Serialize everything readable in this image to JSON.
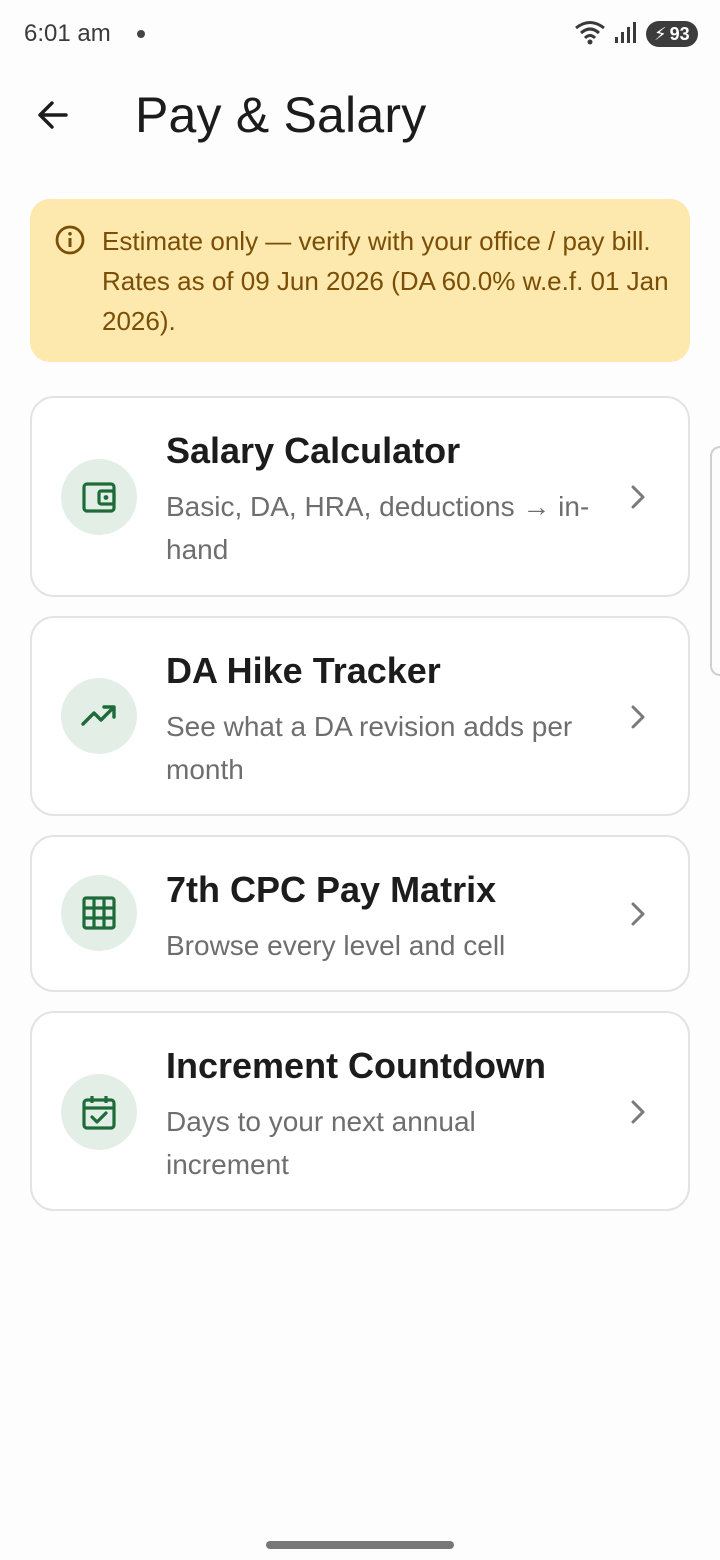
{
  "status_bar": {
    "time": "6:01 am",
    "battery": "93",
    "icons": [
      "wifi-icon",
      "signal-icon",
      "battery-charging-icon"
    ]
  },
  "app_bar": {
    "title": "Pay & Salary",
    "back_icon": "arrow-back-icon"
  },
  "banner": {
    "icon": "info-icon",
    "text": "Estimate only — verify with your office / pay bill. Rates as of 09 Jun 2026 (DA 60.0% w.e.f. 01 Jan 2026).",
    "background_color": "#fde9ae",
    "text_color": "#7a4e06"
  },
  "cards": [
    {
      "title": "Salary Calculator",
      "subtitle": "Basic, DA, HRA, deductions → in-hand",
      "icon": "wallet-icon"
    },
    {
      "title": "DA Hike Tracker",
      "subtitle": "See what a DA revision adds per month",
      "icon": "trending-up-icon"
    },
    {
      "title": "7th CPC Pay Matrix",
      "subtitle": "Browse every level and cell",
      "icon": "grid-icon"
    },
    {
      "title": "Increment Countdown",
      "subtitle": "Days to your next annual increment",
      "icon": "calendar-check-icon"
    }
  ],
  "colors": {
    "accent": "#1e6b3a",
    "icon_bg": "#e3efe6"
  }
}
